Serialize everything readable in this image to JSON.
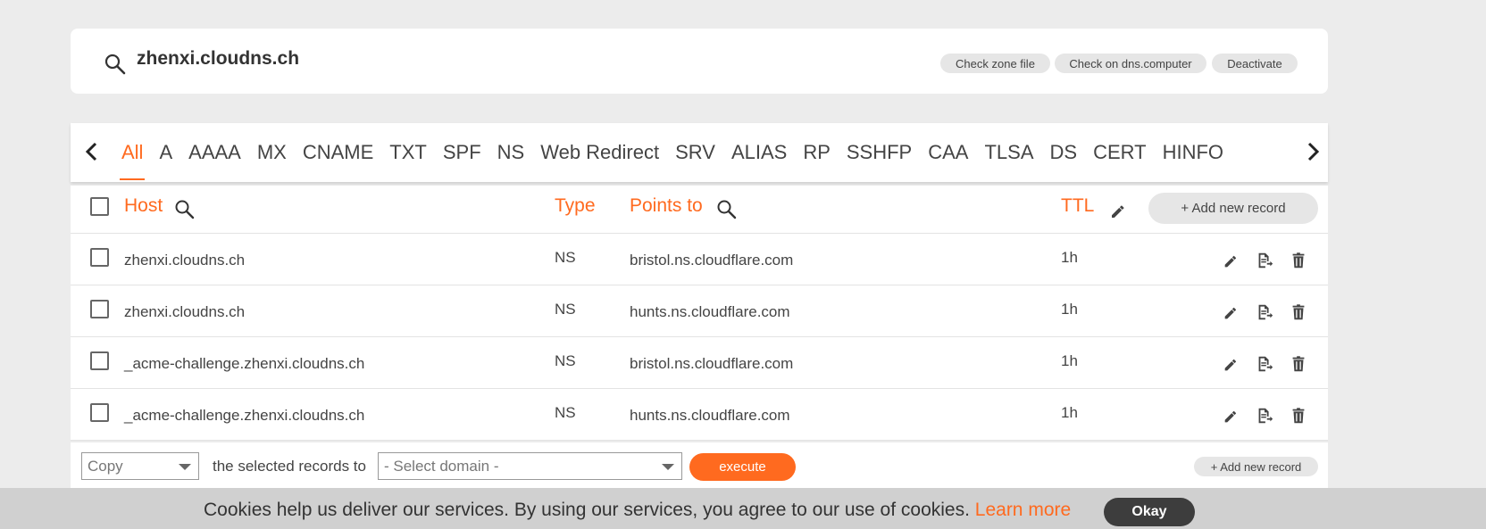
{
  "zone": {
    "name": "zhenxi.cloudns.ch",
    "buttons": {
      "check_zone_file": "Check zone file",
      "check_dns_computer": "Check on dns.computer",
      "deactivate": "Deactivate"
    }
  },
  "tabs": [
    "All",
    "A",
    "AAAA",
    "MX",
    "CNAME",
    "TXT",
    "SPF",
    "NS",
    "Web Redirect",
    "SRV",
    "ALIAS",
    "RP",
    "SSHFP",
    "CAA",
    "TLSA",
    "DS",
    "CERT",
    "HINFO"
  ],
  "active_tab": "All",
  "table": {
    "headers": {
      "host": "Host",
      "type": "Type",
      "points_to": "Points to",
      "ttl": "TTL"
    },
    "add_record_label": "+ Add new record",
    "rows": [
      {
        "host": "zhenxi.cloudns.ch",
        "type": "NS",
        "points_to": "bristol.ns.cloudflare.com",
        "ttl": "1h"
      },
      {
        "host": "zhenxi.cloudns.ch",
        "type": "NS",
        "points_to": "hunts.ns.cloudflare.com",
        "ttl": "1h"
      },
      {
        "host": "_acme-challenge.zhenxi.cloudns.ch",
        "type": "NS",
        "points_to": "bristol.ns.cloudflare.com",
        "ttl": "1h"
      },
      {
        "host": "_acme-challenge.zhenxi.cloudns.ch",
        "type": "NS",
        "points_to": "hunts.ns.cloudflare.com",
        "ttl": "1h"
      }
    ]
  },
  "bulk_actions": {
    "action_value": "Copy",
    "middle_text": "the selected records to",
    "domain_value": "- Select domain -",
    "execute_label": "execute",
    "add_record_label": "+ Add new record"
  },
  "cookie": {
    "message": "Cookies help us deliver our services. By using our services, you agree to our use of cookies.",
    "learn_more": "Learn more",
    "okay": "Okay"
  },
  "colors": {
    "accent": "#ff6a1f",
    "background": "#ececec",
    "cookie_bar": "#d0d0d0",
    "okay_button": "#3d3d3d"
  }
}
